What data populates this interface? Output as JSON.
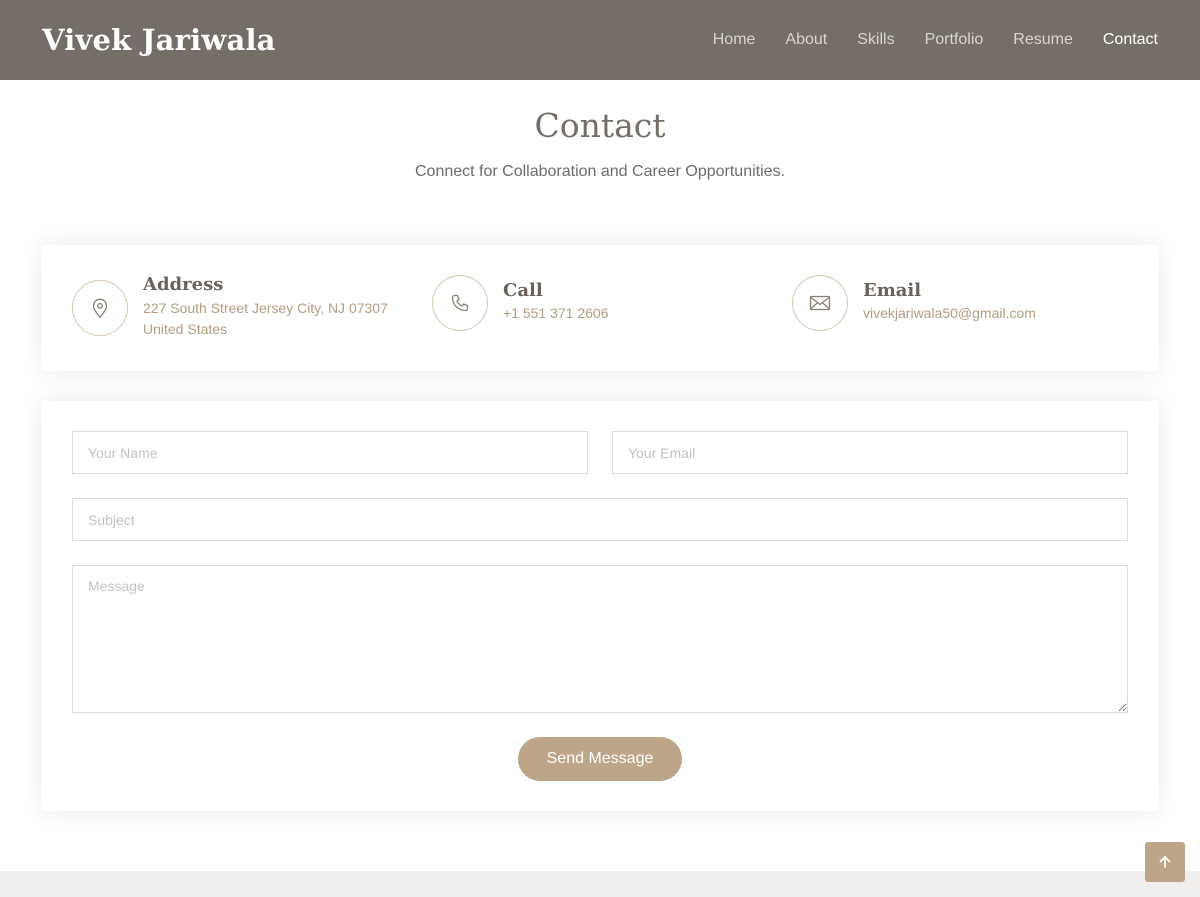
{
  "header": {
    "logo": "Vivek Jariwala",
    "nav": [
      "Home",
      "About",
      "Skills",
      "Portfolio",
      "Resume",
      "Contact"
    ],
    "active_nav": "Contact"
  },
  "section": {
    "title": "Contact",
    "subtitle": "Connect for Collaboration and Career Opportunities."
  },
  "info": {
    "address": {
      "title": "Address",
      "line1": "227 South Street Jersey City, NJ 07307",
      "line2": "United States",
      "icon": "map-pin-icon"
    },
    "call": {
      "title": "Call",
      "text": "+1 551 371 2606",
      "icon": "phone-icon"
    },
    "email": {
      "title": "Email",
      "text": "vivekjariwala50@gmail.com",
      "icon": "envelope-icon"
    }
  },
  "form": {
    "name_placeholder": "Your Name",
    "email_placeholder": "Your Email",
    "subject_placeholder": "Subject",
    "message_placeholder": "Message",
    "name_value": "",
    "email_value": "",
    "subject_value": "",
    "message_value": "",
    "submit_label": "Send Message"
  },
  "back_to_top": {
    "icon": "arrow-up-icon"
  },
  "colors": {
    "header_bg": "#746e67",
    "accent": "#bda587",
    "accent_text": "#b39d82",
    "icon_border": "#d6c7b2"
  }
}
